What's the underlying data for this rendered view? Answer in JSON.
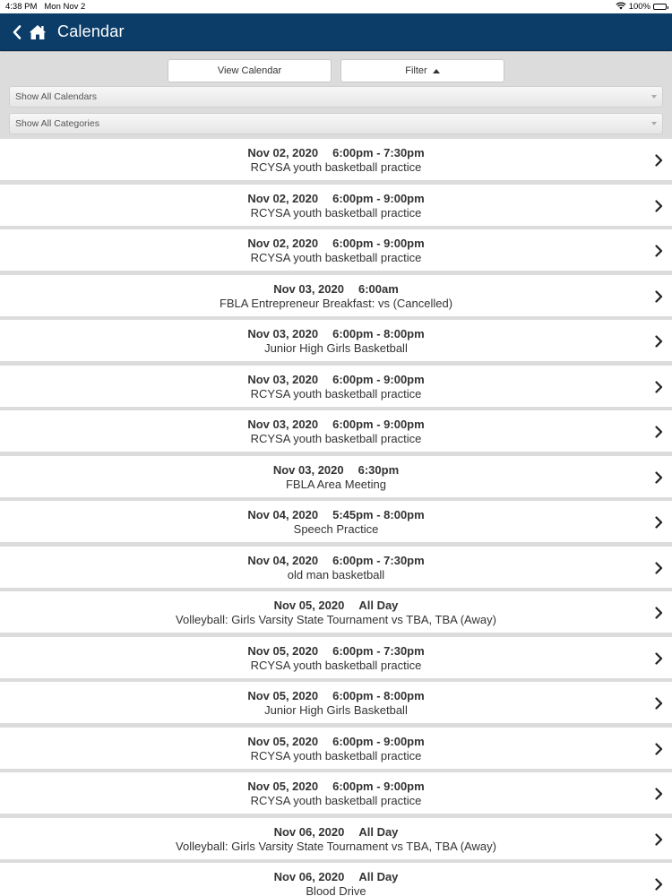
{
  "status": {
    "time": "4:38 PM",
    "date": "Mon Nov 2",
    "battery": "100%"
  },
  "header": {
    "title": "Calendar"
  },
  "controls": {
    "view_calendar_label": "View Calendar",
    "filter_label": "Filter",
    "calendars_select": "Show All Calendars",
    "categories_select": "Show All Categories"
  },
  "colors": {
    "navbar": "#0b3d68",
    "background": "#dcdcdc",
    "row": "#ffffff"
  },
  "events": [
    {
      "date": "Nov 02, 2020",
      "time": "6:00pm - 7:30pm",
      "title": "RCYSA youth basketball practice"
    },
    {
      "date": "Nov 02, 2020",
      "time": "6:00pm - 9:00pm",
      "title": "RCYSA youth basketball practice"
    },
    {
      "date": "Nov 02, 2020",
      "time": "6:00pm - 9:00pm",
      "title": "RCYSA youth basketball practice"
    },
    {
      "date": "Nov 03, 2020",
      "time": "6:00am",
      "title": "FBLA Entrepreneur Breakfast: vs (Cancelled)"
    },
    {
      "date": "Nov 03, 2020",
      "time": "6:00pm - 8:00pm",
      "title": "Junior High Girls Basketball"
    },
    {
      "date": "Nov 03, 2020",
      "time": "6:00pm - 9:00pm",
      "title": "RCYSA youth basketball practice"
    },
    {
      "date": "Nov 03, 2020",
      "time": "6:00pm - 9:00pm",
      "title": "RCYSA youth basketball practice"
    },
    {
      "date": "Nov 03, 2020",
      "time": "6:30pm",
      "title": "FBLA Area Meeting"
    },
    {
      "date": "Nov 04, 2020",
      "time": "5:45pm - 8:00pm",
      "title": "Speech Practice"
    },
    {
      "date": "Nov 04, 2020",
      "time": "6:00pm - 7:30pm",
      "title": "old man basketball"
    },
    {
      "date": "Nov 05, 2020",
      "time": "All Day",
      "title": "Volleyball: Girls Varsity State Tournament vs TBA, TBA (Away)"
    },
    {
      "date": "Nov 05, 2020",
      "time": "6:00pm - 7:30pm",
      "title": "RCYSA youth basketball practice"
    },
    {
      "date": "Nov 05, 2020",
      "time": "6:00pm - 8:00pm",
      "title": "Junior High Girls Basketball"
    },
    {
      "date": "Nov 05, 2020",
      "time": "6:00pm - 9:00pm",
      "title": "RCYSA youth basketball practice"
    },
    {
      "date": "Nov 05, 2020",
      "time": "6:00pm - 9:00pm",
      "title": "RCYSA youth basketball practice"
    },
    {
      "date": "Nov 06, 2020",
      "time": "All Day",
      "title": "Volleyball: Girls Varsity State Tournament vs TBA, TBA (Away)"
    },
    {
      "date": "Nov 06, 2020",
      "time": "All Day",
      "title": "Blood Drive"
    }
  ]
}
